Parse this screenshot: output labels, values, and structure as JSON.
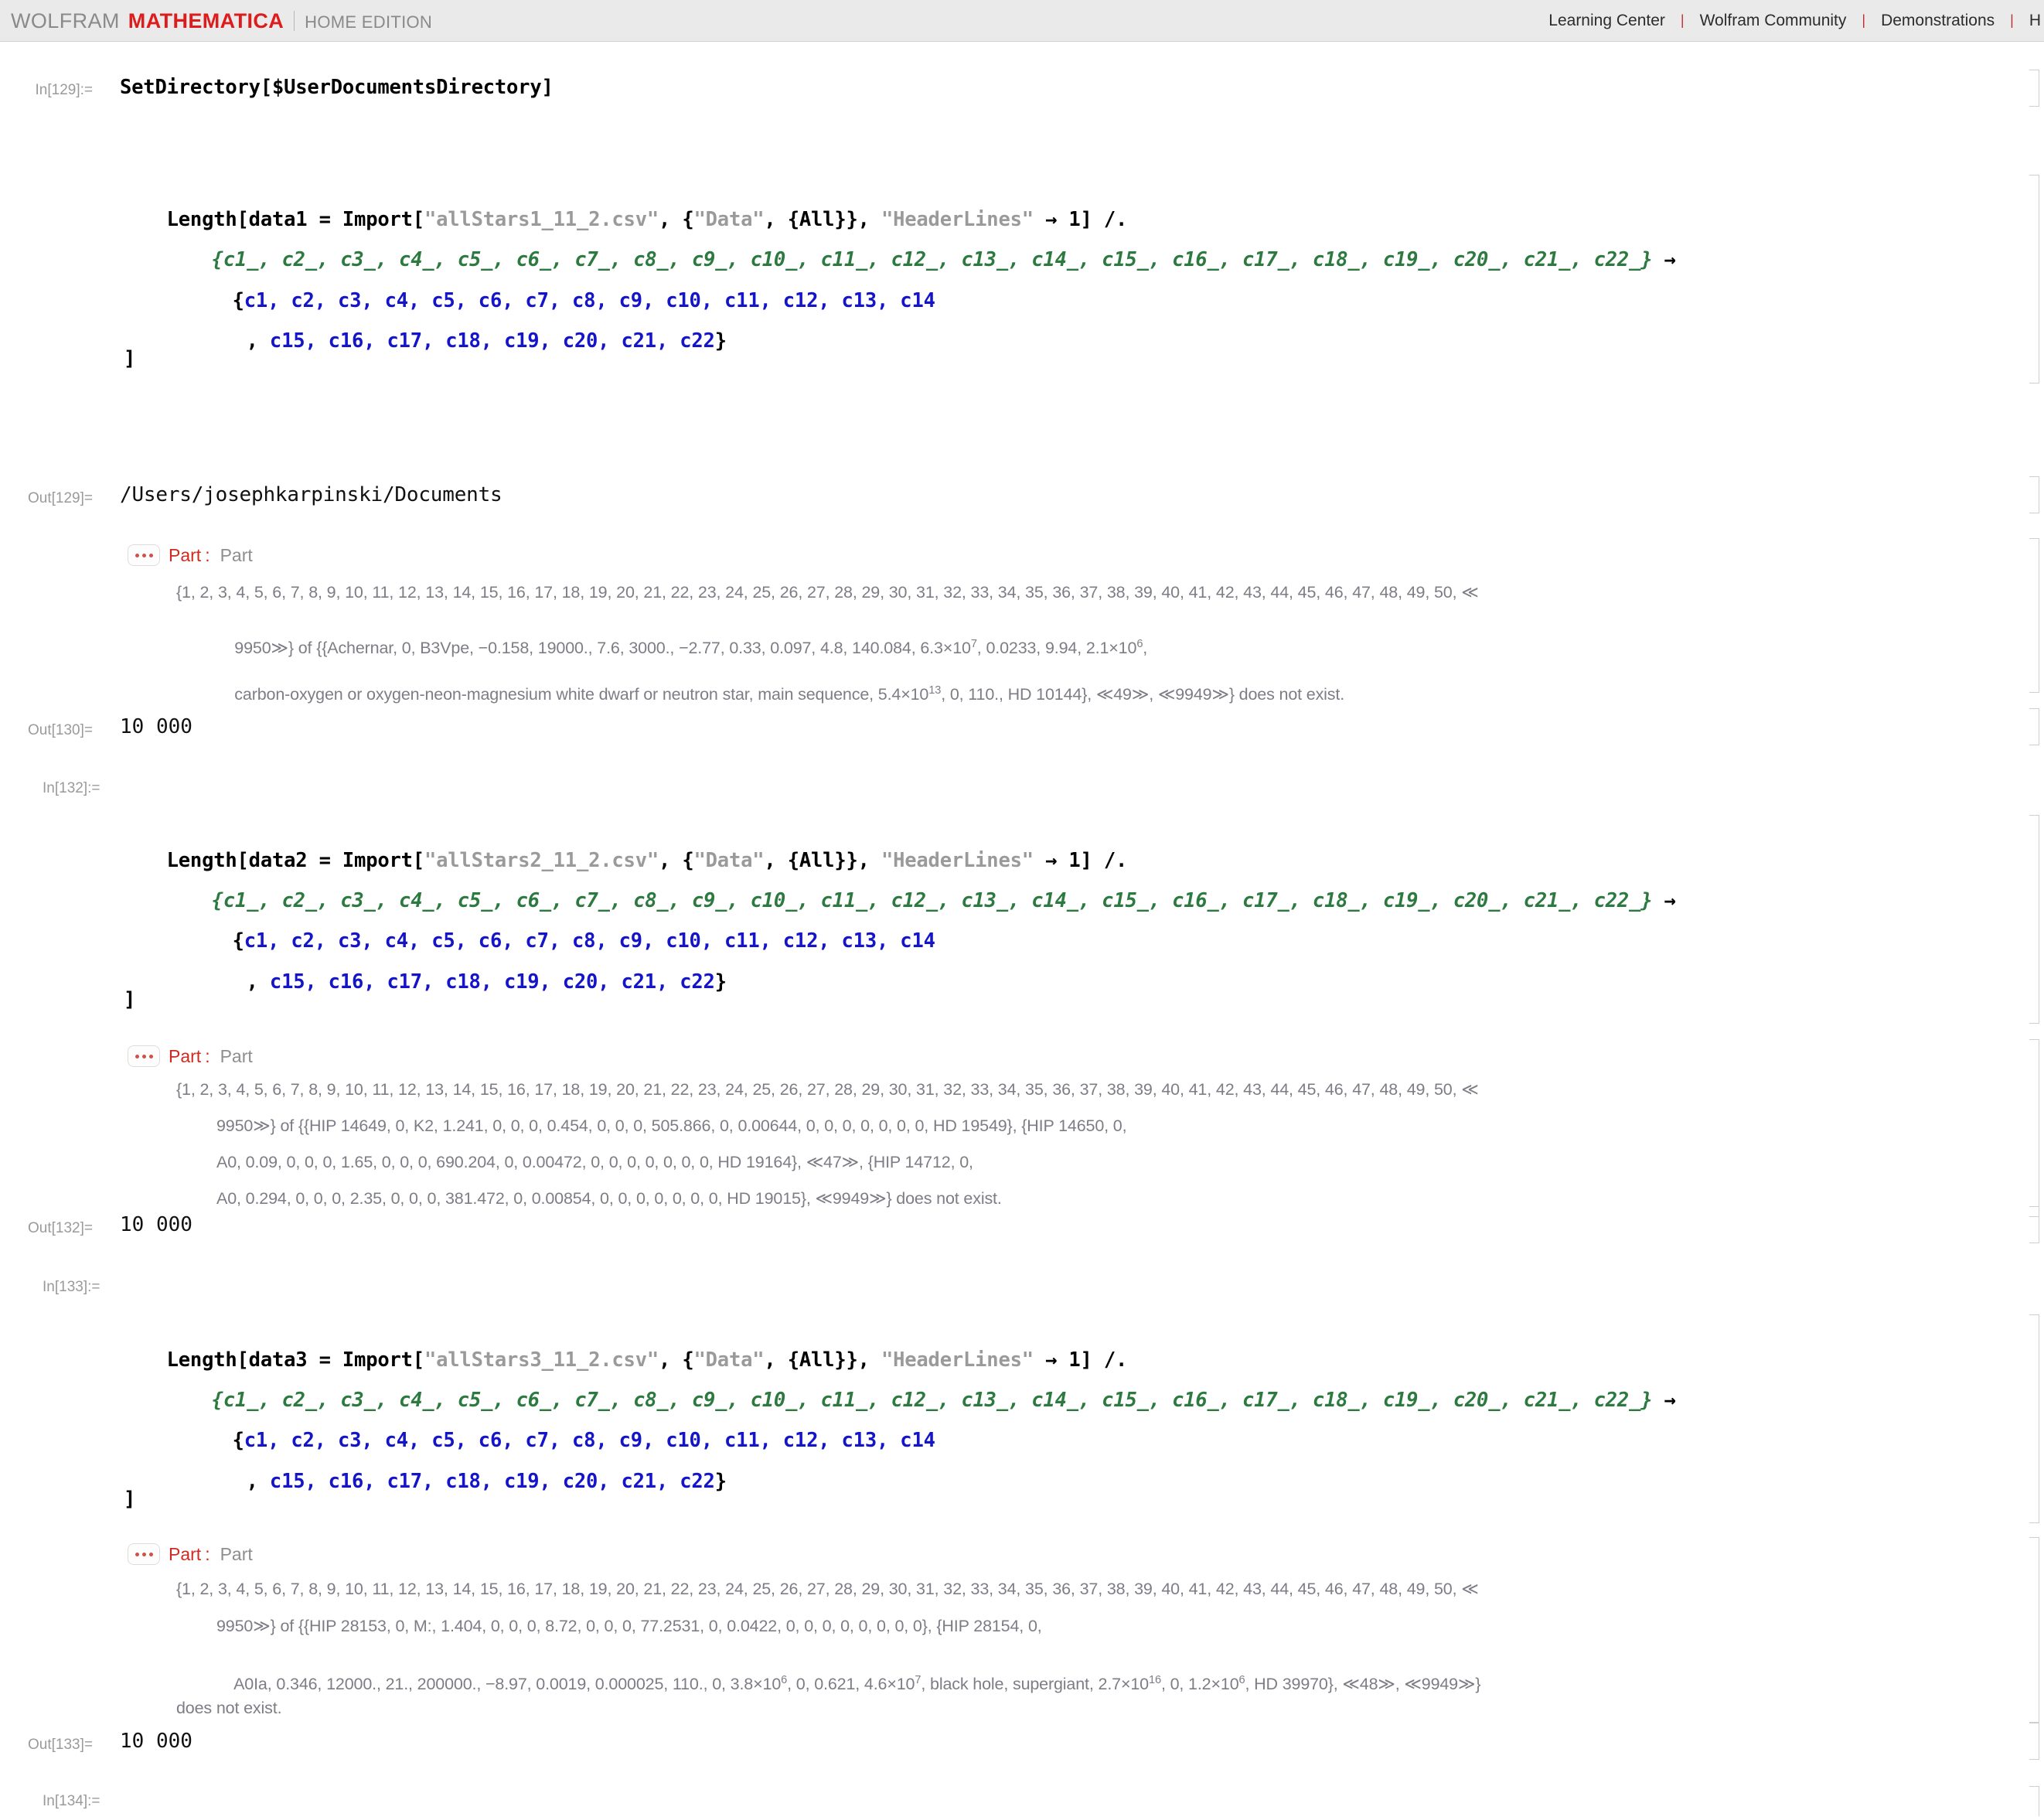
{
  "toolbar": {
    "brand_wolfram": "WOLFRAM",
    "brand_mathematica": "MATHEMATICA",
    "brand_edition": "HOME EDITION",
    "links": [
      "Learning Center",
      "Wolfram Community",
      "Demonstrations",
      "H"
    ],
    "separator": "|"
  },
  "cells": {
    "in129_label": "In[129]:=",
    "in129_line1_func": "SetDirectory[$UserDocumentsDirectory]",
    "in130_l1_a": "Length[data1 = Import[",
    "in130_l1_str1": "\"allStars1_11_2.csv\"",
    "in130_l1_b": ", {",
    "in130_l1_str2": "\"Data\"",
    "in130_l1_c": ", {All}}, ",
    "in130_l1_str3": "\"HeaderLines\"",
    "in130_l1_d": " → 1] /.",
    "in130_l2_patterns": "{c1_, c2_, c3_, c4_, c5_, c6_, c7_, c8_, c9_, c10_, c11_, c12_, c13_, c14_, c15_, c16_, c17_, c18_, c19_, c20_, c21_, c22_}",
    "in130_l2_arrow": " →",
    "in130_l3_open": "{",
    "in130_l3_syms": "c1, c2, c3, c4, c5, c6, c7, c8, c9, c10, c11, c12, c13, c14",
    "in130_l4_comma": ", ",
    "in130_l4_syms": "c15, c16, c17, c18, c19, c20, c21, c22",
    "in130_l4_close": "}",
    "in130_l5_close": "]",
    "out129_label": "Out[129]=",
    "out129_value": "/Users/josephkarpinski/Documents",
    "msg1_badge_name": "Part",
    "msg1_colon": ":",
    "msg1_tag": "Part",
    "msg1_line1": "{1, 2, 3, 4, 5, 6, 7, 8, 9, 10, 11, 12, 13, 14, 15, 16, 17, 18, 19, 20, 21, 22, 23, 24, 25, 26, 27, 28, 29, 30, 31, 32, 33, 34, 35, 36, 37, 38, 39, 40, 41, 42, 43, 44, 45, 46, 47, 48, 49, 50, ≪",
    "msg1_line2_pre": "9950≫} of ",
    "msg1_line2_mid": "{{Achernar, 0, B3Vpe, −0.158, 19000., 7.6, 3000., −2.77, 0.33, 0.097, 4.8, 140.084, 6.3×10",
    "msg1_line2_exp1": "7",
    "msg1_line2_post": ", 0.0233, 9.94, 2.1×10",
    "msg1_line2_exp2": "6",
    "msg1_line2_end": ",",
    "msg1_line3_pre": "carbon-oxygen or oxygen-neon-magnesium white dwarf or neutron star, main sequence, 5.4×10",
    "msg1_line3_exp": "13",
    "msg1_line3_mid": ", 0, 110., HD 10144}, ≪49≫, ≪9949≫}",
    "msg1_line3_end": " does not exist.",
    "out130_label": "Out[130]=",
    "out130_value": "10 000",
    "in132_label": "In[132]:=",
    "in132_l1_a": "Length[data2 = Import[",
    "in132_l1_str1": "\"allStars2_11_2.csv\"",
    "in132_l1_b": ", {",
    "in132_l1_str2": "\"Data\"",
    "in132_l1_c": ", {All}}, ",
    "in132_l1_str3": "\"HeaderLines\"",
    "in132_l1_d": " → 1] /.",
    "msg2_badge_name": "Part",
    "msg2_colon": ":",
    "msg2_tag": "Part",
    "msg2_line1": "{1, 2, 3, 4, 5, 6, 7, 8, 9, 10, 11, 12, 13, 14, 15, 16, 17, 18, 19, 20, 21, 22, 23, 24, 25, 26, 27, 28, 29, 30, 31, 32, 33, 34, 35, 36, 37, 38, 39, 40, 41, 42, 43, 44, 45, 46, 47, 48, 49, 50, ≪",
    "msg2_line2": "9950≫} of {{HIP 14649, 0, K2, 1.241, 0, 0, 0, 0.454, 0, 0, 0, 505.866, 0, 0.00644, 0, 0, 0, 0, 0, 0, 0, HD 19549}, {HIP 14650, 0,",
    "msg2_line3": "A0, 0.09, 0, 0, 0, 1.65, 0, 0, 0, 690.204, 0, 0.00472, 0, 0, 0, 0, 0, 0, 0, HD 19164}, ≪47≫, {HIP 14712, 0,",
    "msg2_line4": "A0, 0.294, 0, 0, 0, 2.35, 0, 0, 0, 381.472, 0, 0.00854, 0, 0, 0, 0, 0, 0, 0, HD 19015}, ≪9949≫} does not exist.",
    "out132_label": "Out[132]=",
    "out132_value": "10 000",
    "in133_label": "In[133]:=",
    "in133_l1_a": "Length[data3 = Import[",
    "in133_l1_str1": "\"allStars3_11_2.csv\"",
    "in133_l1_b": ", {",
    "in133_l1_str2": "\"Data\"",
    "in133_l1_c": ", {All}}, ",
    "in133_l1_str3": "\"HeaderLines\"",
    "in133_l1_d": " → 1] /.",
    "msg3_badge_name": "Part",
    "msg3_colon": ":",
    "msg3_tag": "Part",
    "msg3_line1": "{1, 2, 3, 4, 5, 6, 7, 8, 9, 10, 11, 12, 13, 14, 15, 16, 17, 18, 19, 20, 21, 22, 23, 24, 25, 26, 27, 28, 29, 30, 31, 32, 33, 34, 35, 36, 37, 38, 39, 40, 41, 42, 43, 44, 45, 46, 47, 48, 49, 50, ≪",
    "msg3_line2": "9950≫} of {{HIP 28153, 0, M:, 1.404, 0, 0, 0, 8.72, 0, 0, 0, 77.2531, 0, 0.0422, 0, 0, 0, 0, 0, 0, 0, 0}, {HIP 28154, 0,",
    "msg3_line3_a": "A0Ia, 0.346, 12000., 21., 200000., −8.97, 0.0019, 0.000025, 110., 0, 3.8×10",
    "msg3_line3_e1": "6",
    "msg3_line3_b": ", 0, 0.621, 4.6×10",
    "msg3_line3_e2": "7",
    "msg3_line3_c": ", black hole, supergiant, 2.7×10",
    "msg3_line3_e3": "16",
    "msg3_line3_d": ", 0, 1.2×10",
    "msg3_line3_e4": "6",
    "msg3_line3_e": ", HD 39970}, ≪48≫, ≪9949≫}",
    "msg3_line4": "does not exist.",
    "out133_label": "Out[133]=",
    "out133_value": "10 000",
    "in134_label": "In[134]:="
  }
}
